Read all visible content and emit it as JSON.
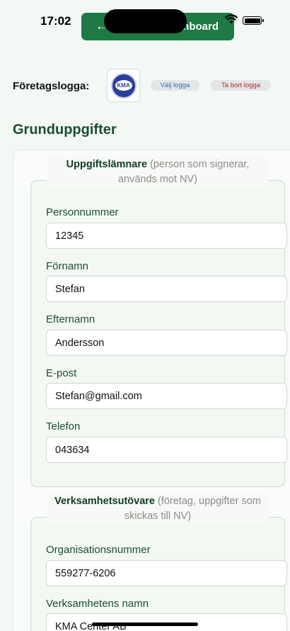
{
  "status_bar": {
    "time": "17:02"
  },
  "header": {
    "back_arrow": "←",
    "back_label": "nboard"
  },
  "logo_section": {
    "label": "Företagslogga:",
    "logo_text": "KMA",
    "choose_label": "Välj logga",
    "remove_label": "Ta bort logga"
  },
  "section_title": "Grunduppgifter",
  "submitter": {
    "legend_title": "Uppgiftslämnare",
    "legend_note": " (person som signerar, används mot NV)",
    "fields": [
      {
        "label": "Personnummer",
        "value": "12345"
      },
      {
        "label": "Förnamn",
        "value": "Stefan"
      },
      {
        "label": "Efternamn",
        "value": "Andersson"
      },
      {
        "label": "E-post",
        "value": "Stefan@gmail.com"
      },
      {
        "label": "Telefon",
        "value": "043634"
      }
    ]
  },
  "operator": {
    "legend_title": "Verksamhetsutövare",
    "legend_note": " (företag, uppgifter som skickas till NV)",
    "fields": [
      {
        "label": "Organisationsnummer",
        "value": "559277-6206"
      },
      {
        "label": "Verksamhetens namn",
        "value": "KMA Center AB"
      }
    ]
  },
  "colors": {
    "primary": "#1e7a45",
    "heading": "#1d4d33",
    "background": "#f3f8f5"
  }
}
